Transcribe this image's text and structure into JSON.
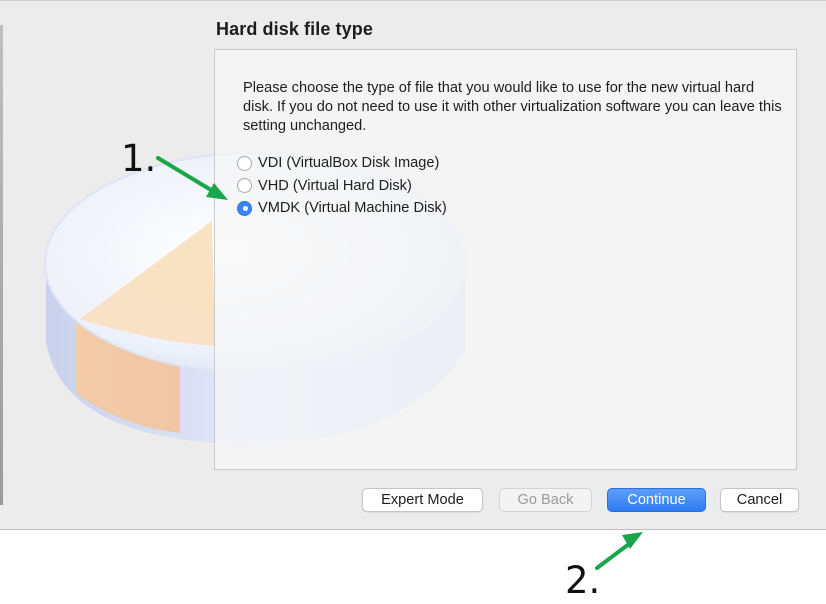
{
  "dialog": {
    "title": "Hard disk file type",
    "description": "Please choose the type of file that you would like to use for the new virtual hard disk. If you do not need to use it with other virtualization software you can leave this setting unchanged."
  },
  "format_options": [
    {
      "label": "VDI (VirtualBox Disk Image)",
      "checked": false
    },
    {
      "label": "VHD (Virtual Hard Disk)",
      "checked": false
    },
    {
      "label": "VMDK (Virtual Machine Disk)",
      "checked": true
    }
  ],
  "buttons": {
    "expert_mode": "Expert Mode",
    "go_back": "Go Back",
    "continue": "Continue",
    "cancel": "Cancel"
  },
  "annotations": {
    "step_1": "1.",
    "step_2": "2.",
    "arrow_color": "#1aa64a"
  },
  "colors": {
    "accent": "#3a86f6",
    "window_bg": "#ececec"
  }
}
